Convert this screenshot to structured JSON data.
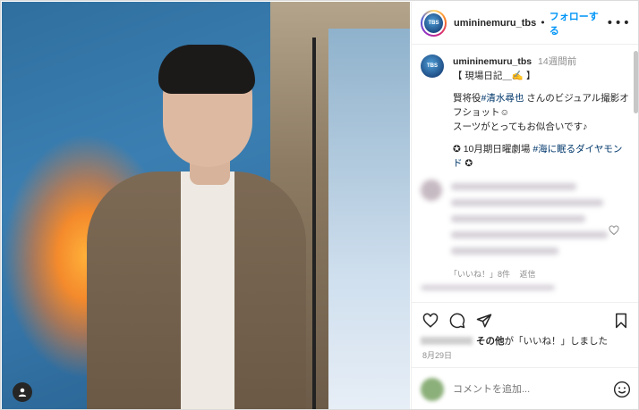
{
  "post": {
    "photo_tag_icon": "person-tag-icon"
  },
  "header": {
    "username": "umininemuru_tbs",
    "separator": "•",
    "follow_label": "フォローする",
    "more_label": "•••",
    "avatar_text": "TBS"
  },
  "caption": {
    "username": "umininemuru_tbs",
    "time": "14週間前",
    "line1": "【 現場日記＿✍ 】",
    "p2_prefix": "賢将役",
    "p2_link": "#清水尋也",
    "p2_suffix": "さんのビジュアル撮影オフショット☺︎",
    "p3": "スーツがとってもお似合いです♪",
    "p4_prefix": "✪ 10月期日曜劇場",
    "p4_link": "#海に眠るダイヤモンド",
    "p4_suffix": "✪"
  },
  "comment_preview": {
    "likes": "「いいね！」8件",
    "reply": "返信"
  },
  "actions": {
    "like_icon": "heart-icon",
    "comment_icon": "comment-icon",
    "share_icon": "share-icon",
    "save_icon": "bookmark-icon"
  },
  "liked_by": {
    "others": "その他",
    "suffix": "が「いいね！」しました"
  },
  "date": "8月29日",
  "comment_box": {
    "placeholder": "コメントを追加..."
  },
  "colors": {
    "accent": "#0095f6",
    "link": "#00376b",
    "muted": "#8e8e8e",
    "border": "#dbdbdb"
  }
}
